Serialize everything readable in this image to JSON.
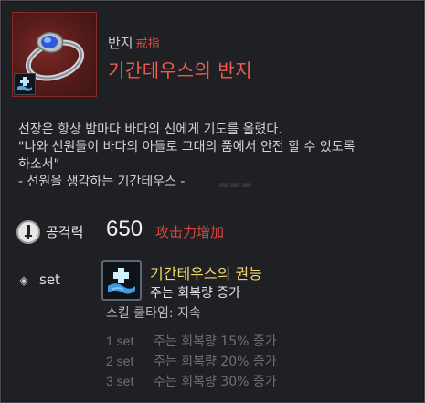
{
  "colors": {
    "background": "#1f2024",
    "name_red": "#f05a4f",
    "cn_red": "#e0453f",
    "skill_gold": "#f4d66a",
    "set_gray": "#6f7074"
  },
  "header": {
    "category": "반지",
    "category_cn": "戒指",
    "name": "기간테우스의 반지",
    "icon": "ring-icon",
    "badge_icon": "heal-skill-icon"
  },
  "description": {
    "line1": "선장은 항상 밤마다 바다의 신에게 기도를 올렸다.",
    "line2": "\"나와 선원들이 바다의 아들로 그대의 품에서 안전 할 수 있도록",
    "line3": "하소서\"",
    "line4": "- 선원을 생각하는 기간테우스 -"
  },
  "stats": {
    "attack_label": "공격력",
    "attack_value": "650",
    "attack_cn": "攻击力增加"
  },
  "set": {
    "label": "set",
    "skill_title": "기간테우스의 권능",
    "skill_sub": "주는 회복량 증가",
    "cooldown": "스킬 쿨타임: 지속",
    "tiers": [
      {
        "count": "1 set",
        "text": "주는 회복량 15% 증가"
      },
      {
        "count": "2 set",
        "text": "주는 회복량 20% 증가"
      },
      {
        "count": "3 set",
        "text": "주는 회복량 30% 증가"
      }
    ]
  }
}
